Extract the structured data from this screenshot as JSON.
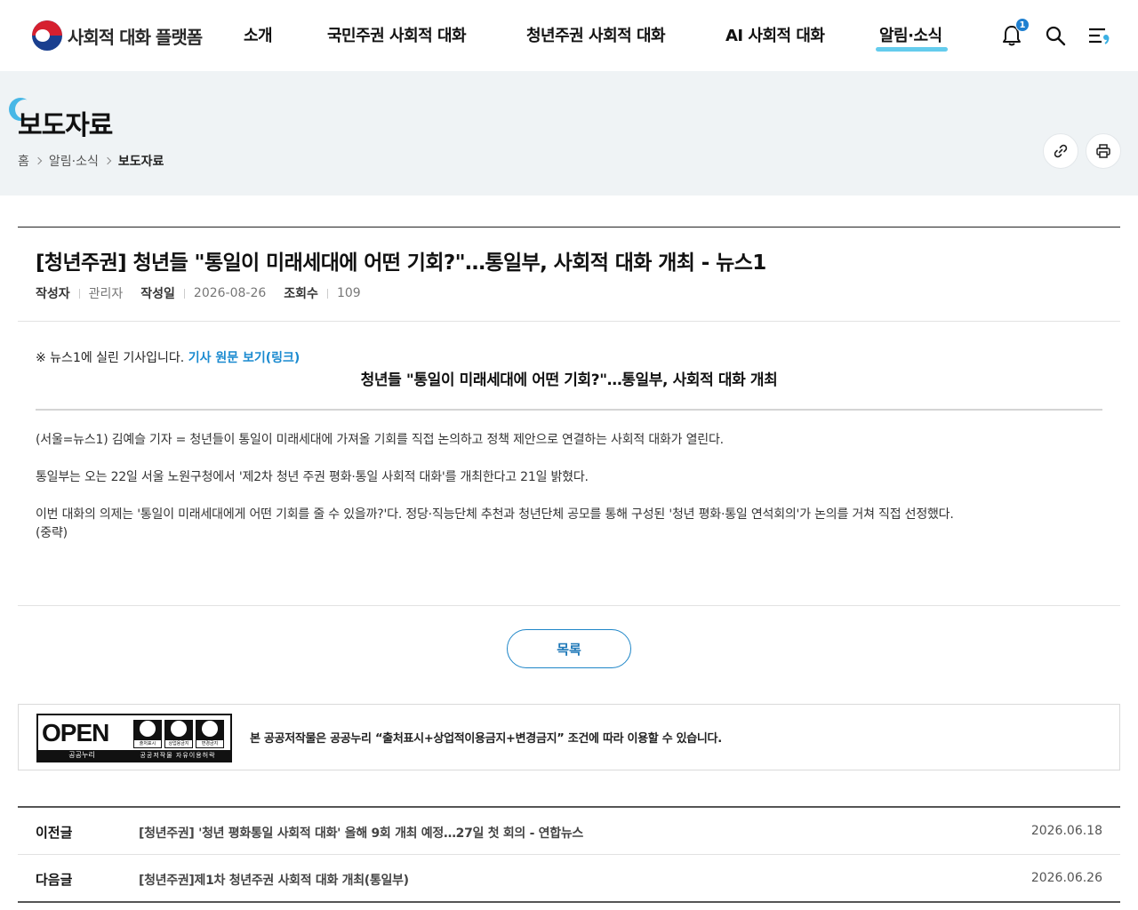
{
  "header": {
    "logo_text": "사회적 대화 플랫폼",
    "nav": [
      "소개",
      "국민주권 사회적 대화",
      "청년주권 사회적 대화",
      "AI 사회적 대화",
      "알림·소식"
    ],
    "active_nav": "알림·소식",
    "notification_count": "1",
    "icons": [
      "bell-icon",
      "search-icon",
      "menu-icon"
    ]
  },
  "subvisual": {
    "title": "보도자료",
    "breadcrumb": [
      "홈",
      "알림·소식",
      "보도자료"
    ],
    "utility_icons": [
      "link-icon",
      "print-icon"
    ]
  },
  "article": {
    "title": "[청년주권] 청년들 \"통일이 미래세대에 어떤 기회?\"…통일부, 사회적 대화 개최 - 뉴스1",
    "meta": {
      "author_label": "작성자",
      "author": "관리자",
      "date_label": "작성일",
      "date": "2026-08-26",
      "views_label": "조회수",
      "views": "109"
    },
    "notice_prefix": "※ 뉴스1에 실린 기사입니다.",
    "notice_link": "기사 원문 보기(링크)",
    "headline": "청년들 \"통일이 미래세대에 어떤 기회?\"…통일부, 사회적 대화 개최",
    "paragraphs": [
      "(서울=뉴스1) 김예슬 기자 = 청년들이 통일이 미래세대에 가져올 기회를 직접 논의하고 정책 제안으로 연결하는 사회적 대화가 열린다.",
      "통일부는 오는 22일 서울 노원구청에서 '제2차 청년 주권 평화·통일 사회적 대화'를 개최한다고 21일 밝혔다.",
      "이번 대화의 의제는 '통일이 미래세대에게 어떤 기회를 줄 수 있을까?'다. 정당·직능단체 추천과 청년단체 공모를 통해 구성된 '청년 평화·통일 연석회의'가 논의를 거쳐 직접 선정했다.",
      "(중략)"
    ]
  },
  "list_button": "목록",
  "license": {
    "badge_open": "OPEN",
    "badge_sub1": "공공누리",
    "badge_sub2": "공공저작물 자유이용허락",
    "badge_icons": [
      "출처표시",
      "상업용금지",
      "변경금지"
    ],
    "text": "본 공공저작물은 공공누리 “출처표시+상업적이용금지+변경금지” 조건에 따라 이용할 수 있습니다."
  },
  "post_nav": {
    "prev": {
      "label": "이전글",
      "title": "[청년주권] '청년 평화통일 사회적 대화' 올해 9회 개최 예정…27일 첫 회의 - 연합뉴스",
      "date": "2026.06.18"
    },
    "next": {
      "label": "다음글",
      "title": "[청년주권]제1차 청년주권 사회적 대화 개최(통일부)",
      "date": "2026.06.26"
    }
  }
}
